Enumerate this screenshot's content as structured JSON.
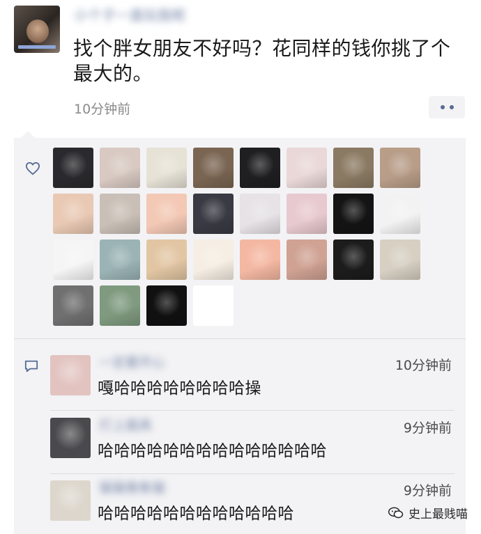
{
  "post": {
    "author_name": "小个子一直玩我呢",
    "text": "找个胖女朋友不好吗？花同样的钱你挑了个最大的。",
    "time": "10分钟前"
  },
  "likes": {
    "count": 28,
    "colors": [
      "#2a2a2e",
      "#d8c9c2",
      "#e7e2d6",
      "#7a6552",
      "#1f1f22",
      "#e9d8d7",
      "#8b7a63",
      "#b89d88",
      "#e9c9b4",
      "#c9bfb6",
      "#f3c8b4",
      "#3a3a44",
      "#e6e2e6",
      "#e7c9cf",
      "#141414",
      "#f2f2f2",
      "#f5f5f5",
      "#9bb3b5",
      "#e2c6a3",
      "#f6eee4",
      "#f4b8a2",
      "#cfa293",
      "#1c1c1c",
      "#d7cfc2",
      "#707070",
      "#7f9a7f",
      "#111111",
      "#ffffff"
    ]
  },
  "comments": [
    {
      "name": "一定要开心",
      "time": "10分钟前",
      "text": "嘎哈哈哈哈哈哈哈哈操",
      "avatar_color": "#e2c3c0"
    },
    {
      "name": "打上面具",
      "time": "9分钟前",
      "text": "哈哈哈哈哈哈哈哈哈哈哈哈哈哈",
      "avatar_color": "#4a4a4e"
    },
    {
      "name": "猫猫像象猫",
      "time": "9分钟前",
      "text": "哈哈哈哈哈哈哈哈哈哈哈哈",
      "avatar_color": "#dcd6cc"
    }
  ],
  "watermark": {
    "text": "史上最贱喵"
  }
}
